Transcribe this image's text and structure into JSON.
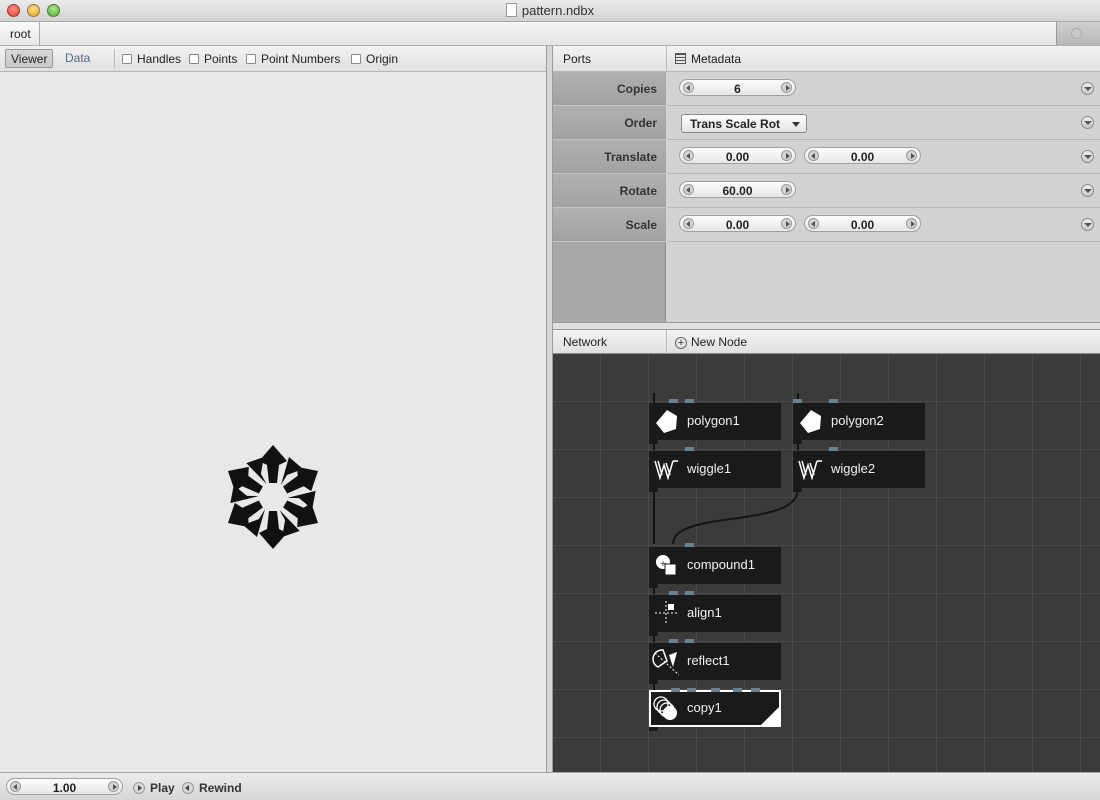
{
  "window": {
    "title": "pattern.ndbx"
  },
  "breadcrumb": {
    "root": "root"
  },
  "viewer": {
    "tabs": {
      "viewer": "Viewer",
      "data": "Data"
    },
    "options": {
      "handles": "Handles",
      "points": "Points",
      "point_numbers": "Point Numbers",
      "origin": "Origin"
    }
  },
  "ports": {
    "title": "Ports",
    "metadata": "Metadata",
    "copies": {
      "label": "Copies",
      "value": "6"
    },
    "order": {
      "label": "Order",
      "value": "Trans Scale Rot"
    },
    "translate": {
      "label": "Translate",
      "x": "0.00",
      "y": "0.00"
    },
    "rotate": {
      "label": "Rotate",
      "value": "60.00"
    },
    "scale": {
      "label": "Scale",
      "x": "0.00",
      "y": "0.00"
    }
  },
  "network": {
    "title": "Network",
    "new_node": "New Node",
    "nodes": {
      "polygon1": "polygon1",
      "polygon2": "polygon2",
      "wiggle1": "wiggle1",
      "wiggle2": "wiggle2",
      "compound1": "compound1",
      "align1": "align1",
      "reflect1": "reflect1",
      "copy1": "copy1"
    }
  },
  "bottom": {
    "frame": "1.00",
    "play": "Play",
    "rewind": "Rewind"
  },
  "colors": {
    "network_bg": "#3b3b3b",
    "node_bg": "#1a1a1a",
    "port_color": "#6c7f8d",
    "rendered_node_border": "#ffffff"
  }
}
